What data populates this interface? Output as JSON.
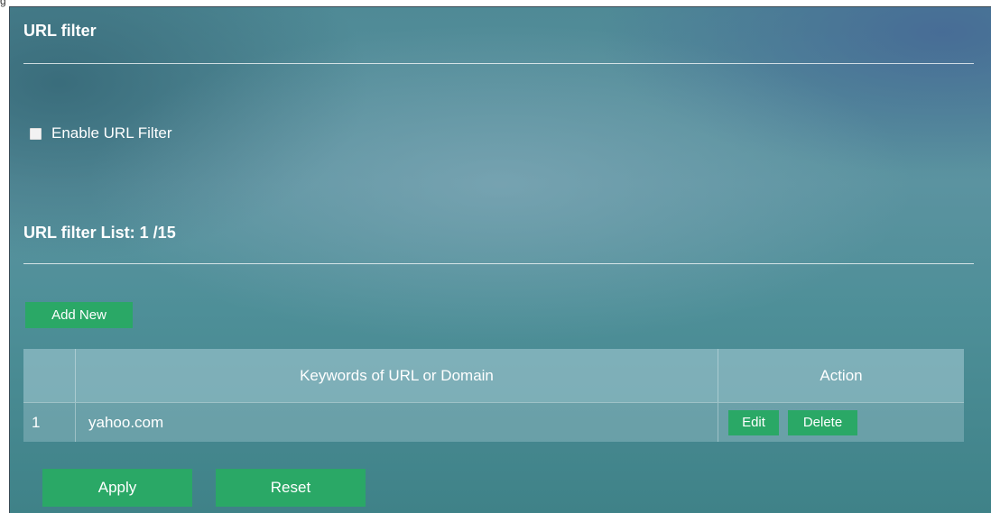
{
  "header": {
    "corner_text": "g"
  },
  "url_filter": {
    "title": "URL filter",
    "enable_label": "Enable URL Filter",
    "enable_checked": false
  },
  "list": {
    "title": "URL filter List: 1 /15",
    "add_button": "Add New",
    "columns": [
      "",
      "Keywords of URL or Domain",
      "Action"
    ],
    "rows": [
      {
        "index": "1",
        "keyword": "yahoo.com",
        "edit_label": "Edit",
        "delete_label": "Delete"
      }
    ]
  },
  "footer": {
    "apply_label": "Apply",
    "reset_label": "Reset"
  },
  "colors": {
    "button": "#2aa866",
    "text": "#ffffff"
  }
}
